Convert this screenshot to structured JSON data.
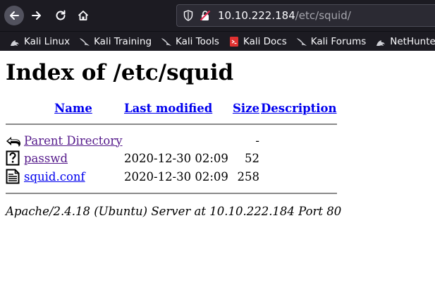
{
  "browser": {
    "url_host": "10.10.222.184",
    "url_path": "/etc/squid/",
    "bookmarks": [
      {
        "label": "Kali Linux",
        "icon": "kali-dragon-icon"
      },
      {
        "label": "Kali Training",
        "icon": "kali-dragon-icon"
      },
      {
        "label": "Kali Tools",
        "icon": "kali-dragon-icon"
      },
      {
        "label": "Kali Docs",
        "icon": "kali-docs-icon"
      },
      {
        "label": "Kali Forums",
        "icon": "kali-dragon-icon"
      },
      {
        "label": "NetHunter",
        "icon": "kali-dragon-icon"
      }
    ]
  },
  "page": {
    "title": "Index of /etc/squid",
    "columns": {
      "name": "Name",
      "last_modified": "Last modified",
      "size": "Size",
      "description": "Description"
    },
    "rows": [
      {
        "name": "Parent Directory",
        "modified": "",
        "size": "-",
        "description": "",
        "icon": "back-arrow-icon"
      },
      {
        "name": "passwd",
        "modified": "2020-12-30 02:09",
        "size": "52",
        "description": "",
        "icon": "unknown-file-icon"
      },
      {
        "name": "squid.conf",
        "modified": "2020-12-30 02:09",
        "size": "258",
        "description": "",
        "icon": "text-file-icon"
      }
    ],
    "footer": "Apache/2.4.18 (Ubuntu) Server at 10.10.222.184 Port 80"
  }
}
